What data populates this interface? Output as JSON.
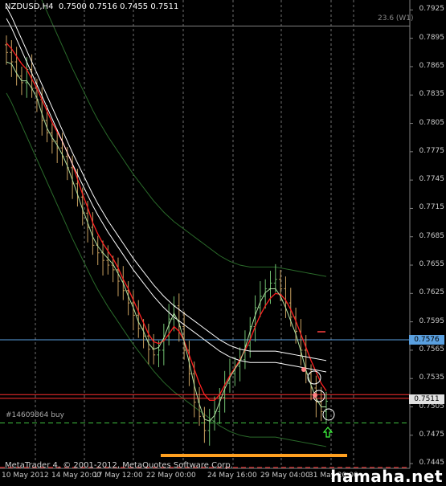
{
  "header": {
    "symbol": "NZDUSD,H4",
    "ohlc": "0.7500 0.7516 0.7455 0.7511"
  },
  "fibo_label": "23.6 (W1)",
  "order_label": "#14609864 buy",
  "copyright": "MetaTrader 4, © 2001-2012, MetaQuotes Software Corp.",
  "watermark": "hamaha.net",
  "price_boxes": {
    "blue_level": "0.7576",
    "current": "0.7511"
  },
  "colors": {
    "background": "#000000",
    "grid": "#808080",
    "candles": "#c8a060",
    "ema_fast": "#ff2020",
    "ma_slow": "#ffffff",
    "bands": "#2a6a2a",
    "signal_line": "#b0e0a0",
    "blue_level": "#5aa0e0",
    "orange_bar": "#ffa020"
  },
  "chart_data": {
    "type": "line",
    "ylim": [
      0.744,
      0.7927
    ],
    "y_ticks": [
      "0.7925",
      "0.7895",
      "0.7865",
      "0.7835",
      "0.7805",
      "0.7775",
      "0.7745",
      "0.7715",
      "0.7685",
      "0.7655",
      "0.7625",
      "0.7595",
      "0.7565",
      "0.7535",
      "0.7505",
      "0.7475",
      "0.7445"
    ],
    "x_ticks": [
      "10 May 2012",
      "14 May 20:00",
      "17 May 12:00",
      "22 May 00:00",
      "24 May 16:00",
      "29 May 04:00",
      "31 May 20:00"
    ],
    "candles": {
      "count": 64,
      "close_approx": [
        0.788,
        0.787,
        0.7855,
        0.7848,
        0.7862,
        0.7842,
        0.783,
        0.7808,
        0.7795,
        0.7786,
        0.7779,
        0.777,
        0.7758,
        0.7741,
        0.7727,
        0.771,
        0.7695,
        0.7676,
        0.7668,
        0.766,
        0.7655,
        0.765,
        0.7638,
        0.7628,
        0.7615,
        0.7602,
        0.7588,
        0.758,
        0.7566,
        0.756,
        0.7565,
        0.758,
        0.7598,
        0.7612,
        0.759,
        0.7565,
        0.754,
        0.751,
        0.7495,
        0.748,
        0.749,
        0.75,
        0.7515,
        0.753,
        0.754,
        0.7548,
        0.7555,
        0.757,
        0.759,
        0.761,
        0.7622,
        0.763,
        0.7636,
        0.764,
        0.763,
        0.7615,
        0.76,
        0.7585,
        0.7565,
        0.754,
        0.7525,
        0.751,
        0.75,
        0.7511
      ]
    },
    "series": [
      {
        "values": [
          0.789,
          0.7884,
          0.7876,
          0.7868,
          0.7862,
          0.7852,
          0.7842,
          0.783,
          0.7818,
          0.7806,
          0.7796,
          0.7786,
          0.7774,
          0.7762,
          0.7746,
          0.773,
          0.7716,
          0.77,
          0.7688,
          0.7678,
          0.767,
          0.7662,
          0.7652,
          0.764,
          0.763,
          0.7618,
          0.7606,
          0.7594,
          0.7582,
          0.7574,
          0.7572,
          0.7575,
          0.7582,
          0.759,
          0.7585,
          0.7575,
          0.756,
          0.7545,
          0.753,
          0.7518,
          0.7512,
          0.7512,
          0.7518,
          0.7528,
          0.7538,
          0.7546,
          0.7555,
          0.7565,
          0.7576,
          0.759,
          0.7602,
          0.7612,
          0.762,
          0.7625,
          0.7624,
          0.7618,
          0.7608,
          0.7596,
          0.7582,
          0.7568,
          0.7554,
          0.7542,
          0.753,
          0.7522
        ]
      },
      {
        "values": [
          0.7922,
          0.7912,
          0.79,
          0.7888,
          0.7876,
          0.7864,
          0.7852,
          0.784,
          0.7828,
          0.7816,
          0.7804,
          0.7792,
          0.778,
          0.7768,
          0.7757,
          0.7746,
          0.7735,
          0.7724,
          0.7714,
          0.7705,
          0.7696,
          0.7688,
          0.768,
          0.7672,
          0.7664,
          0.7656,
          0.7649,
          0.7642,
          0.7635,
          0.7628,
          0.7622,
          0.7616,
          0.7611,
          0.7606,
          0.7602,
          0.7598,
          0.7594,
          0.759,
          0.7586,
          0.7582,
          0.7578,
          0.7574,
          0.757,
          0.7567,
          0.7564,
          0.7562,
          0.756,
          0.7559,
          0.7558,
          0.7558,
          0.7558,
          0.7558,
          0.7558,
          0.7558,
          0.7557,
          0.7556,
          0.7555,
          0.7554,
          0.7553,
          0.7552,
          0.7551,
          0.755,
          0.7549,
          0.7548
        ]
      },
      {
        "values": [
          0.787,
          0.7868,
          0.7858,
          0.785,
          0.785,
          0.7842,
          0.7832,
          0.7815,
          0.78,
          0.779,
          0.7782,
          0.7772,
          0.776,
          0.7745,
          0.773,
          0.7714,
          0.77,
          0.7685,
          0.7675,
          0.7668,
          0.7662,
          0.7656,
          0.7646,
          0.7636,
          0.7622,
          0.761,
          0.7595,
          0.7585,
          0.7572,
          0.7566,
          0.7568,
          0.7578,
          0.7592,
          0.7604,
          0.7594,
          0.7574,
          0.7552,
          0.7528,
          0.7508,
          0.7492,
          0.749,
          0.7496,
          0.751,
          0.7524,
          0.7536,
          0.7545,
          0.7553,
          0.7567,
          0.7585,
          0.7602,
          0.7616,
          0.7626,
          0.763,
          0.763,
          0.7622,
          0.761,
          0.7596,
          0.7582,
          0.7564,
          0.7544,
          0.7528,
          0.7514,
          0.7505,
          0.7505
        ]
      }
    ],
    "levels": [
      {
        "value": 0.7908,
        "color": "#808080"
      },
      {
        "value": 0.7576,
        "color": "#5aa0e0"
      },
      {
        "value": 0.7518,
        "color": "#ff3030"
      },
      {
        "value": 0.7514,
        "color": "#ff3030"
      },
      {
        "value": 0.7488,
        "color": "#40c040",
        "dashed": true
      },
      {
        "value": 0.7441,
        "color": "#ff3030",
        "dashed": true
      }
    ]
  }
}
